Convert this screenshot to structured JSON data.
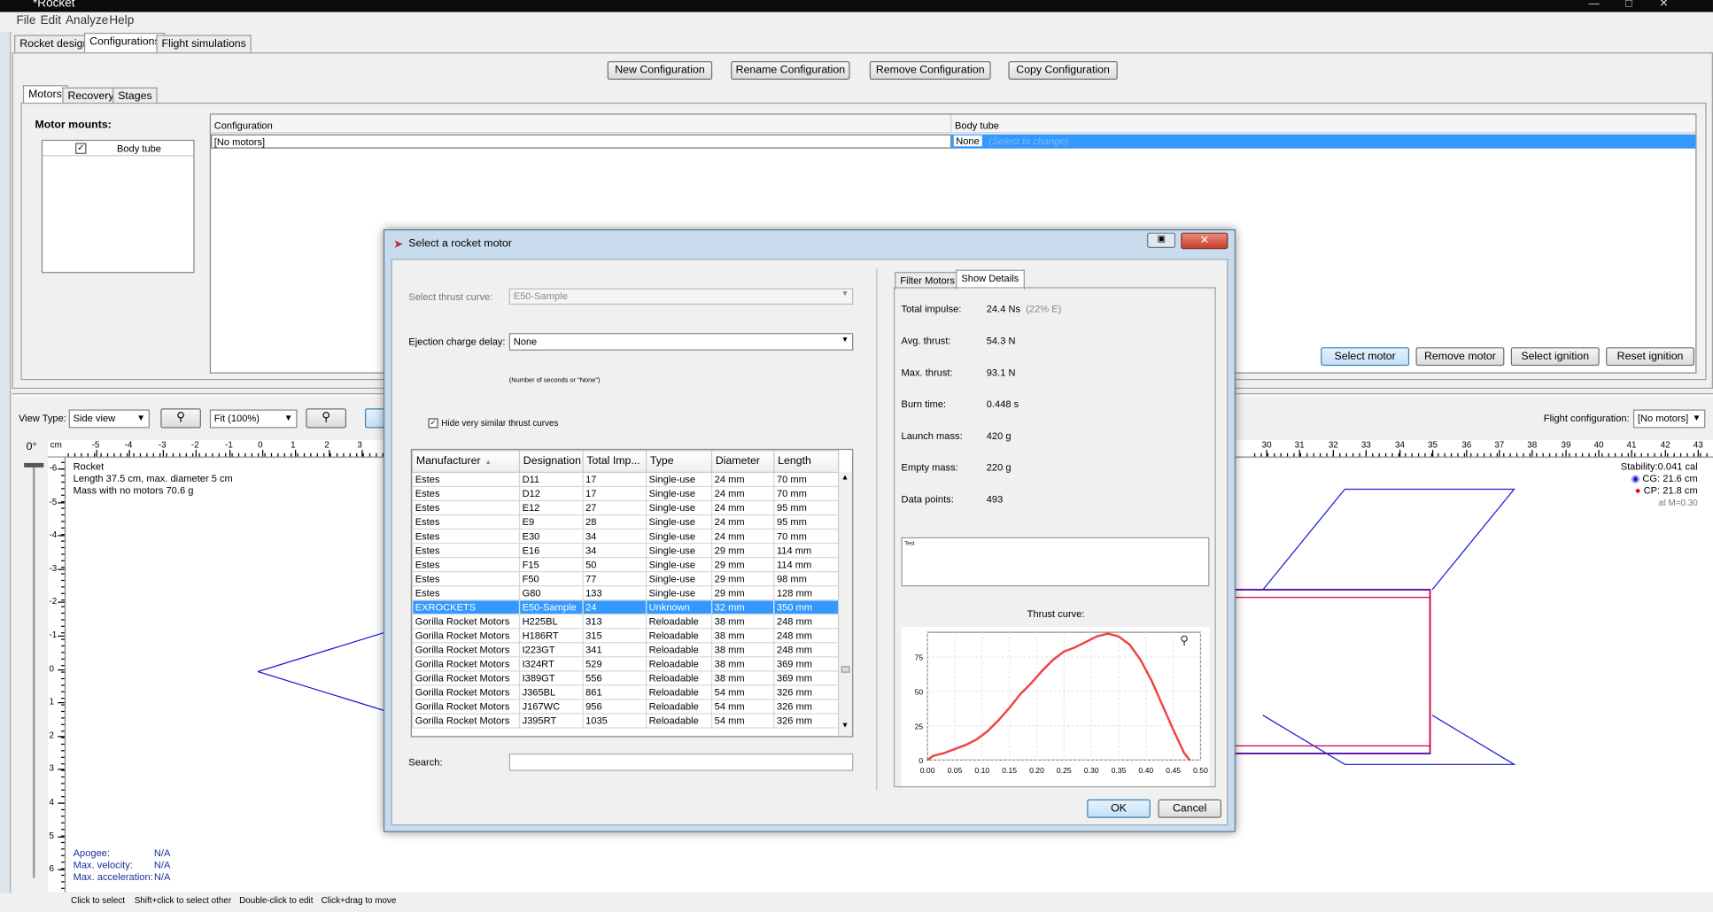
{
  "window": {
    "title": "*Rocket"
  },
  "menu": [
    "File",
    "Edit",
    "Analyze",
    "Help"
  ],
  "main_tabs": [
    "Rocket design",
    "Configurations",
    "Flight simulations"
  ],
  "config_buttons": [
    "New Configuration",
    "Rename Configuration",
    "Remove Configuration",
    "Copy Configuration"
  ],
  "sub_tabs": [
    "Motors",
    "Recovery",
    "Stages"
  ],
  "motor_mounts": {
    "label": "Motor mounts:",
    "item": "Body tube"
  },
  "config_table": {
    "headers": [
      "Configuration",
      "Body tube"
    ],
    "row": [
      "[No motors]",
      "None"
    ],
    "selected_placeholder": "(Select to change)"
  },
  "motor_buttons": [
    "Select motor",
    "Remove motor",
    "Select ignition",
    "Reset ignition"
  ],
  "view": {
    "type_label": "View Type:",
    "type_value": "Side view",
    "zoom": "Fit (100%)",
    "flight_config_label": "Flight configuration:",
    "flight_config_value": "[No motors]",
    "angle": "0°",
    "unit": "cm"
  },
  "rocket_info": {
    "name": "Rocket",
    "length": "Length 37.5 cm, max. diameter 5 cm",
    "mass": "Mass with no motors 70.6 g"
  },
  "stability": {
    "stability": "Stability:",
    "stab_val": "0.041 cal",
    "cg_label": "CG:",
    "cg": "21.6 cm",
    "cp_label": "CP:",
    "cp": "21.8 cm",
    "mach": "at M=0.30"
  },
  "flight_info": {
    "apogee_label": "Apogee:",
    "velocity_label": "Max. velocity:",
    "accel_label": "Max. acceleration:",
    "apogee": "N/A",
    "velocity": "N/A",
    "accel": "N/A"
  },
  "status_bar": [
    "Click to select",
    "Shift+click to select other",
    "Double-click to edit",
    "Click+drag to move"
  ],
  "ruler_h": [
    "-5",
    "-4",
    "-3",
    "-2",
    "-1",
    "0",
    "1",
    "2",
    "3",
    "30",
    "31",
    "32",
    "33",
    "34",
    "35",
    "36",
    "37",
    "38",
    "39",
    "40",
    "41",
    "42",
    "43"
  ],
  "ruler_v": [
    "-6",
    "-5",
    "-4",
    "-3",
    "-2",
    "-1",
    "0",
    "1",
    "2",
    "3",
    "4",
    "5",
    "6"
  ],
  "dialog": {
    "title": "Select a rocket motor",
    "thrust_curve_label": "Select thrust curve:",
    "thrust_curve_value": "E50-Sample",
    "ejection_label": "Ejection charge delay:",
    "ejection_value": "None",
    "ejection_hint": "(Number of seconds or \"None\")",
    "hide_similar": "Hide very similar thrust curves",
    "search_label": "Search:",
    "tabs": [
      "Filter Motors",
      "Show Details"
    ],
    "ok": "OK",
    "cancel": "Cancel",
    "table_headers": [
      "Manufacturer",
      "Designation",
      "Total Imp...",
      "Type",
      "Diameter",
      "Length"
    ],
    "rows": [
      [
        "Estes",
        "D11",
        "17",
        "Single-use",
        "24 mm",
        "70 mm"
      ],
      [
        "Estes",
        "D12",
        "17",
        "Single-use",
        "24 mm",
        "70 mm"
      ],
      [
        "Estes",
        "E12",
        "27",
        "Single-use",
        "24 mm",
        "95 mm"
      ],
      [
        "Estes",
        "E9",
        "28",
        "Single-use",
        "24 mm",
        "95 mm"
      ],
      [
        "Estes",
        "E30",
        "34",
        "Single-use",
        "24 mm",
        "70 mm"
      ],
      [
        "Estes",
        "E16",
        "34",
        "Single-use",
        "29 mm",
        "114 mm"
      ],
      [
        "Estes",
        "F15",
        "50",
        "Single-use",
        "29 mm",
        "114 mm"
      ],
      [
        "Estes",
        "F50",
        "77",
        "Single-use",
        "29 mm",
        "98 mm"
      ],
      [
        "Estes",
        "G80",
        "133",
        "Single-use",
        "29 mm",
        "128 mm"
      ],
      [
        "EXROCKETS",
        "E50-Sample",
        "24",
        "Unknown",
        "32 mm",
        "350 mm"
      ],
      [
        "Gorilla Rocket Motors",
        "H225BL",
        "313",
        "Reloadable",
        "38 mm",
        "248 mm"
      ],
      [
        "Gorilla Rocket Motors",
        "H186RT",
        "315",
        "Reloadable",
        "38 mm",
        "248 mm"
      ],
      [
        "Gorilla Rocket Motors",
        "I223GT",
        "341",
        "Reloadable",
        "38 mm",
        "248 mm"
      ],
      [
        "Gorilla Rocket Motors",
        "I324RT",
        "529",
        "Reloadable",
        "38 mm",
        "369 mm"
      ],
      [
        "Gorilla Rocket Motors",
        "I389GT",
        "556",
        "Reloadable",
        "38 mm",
        "369 mm"
      ],
      [
        "Gorilla Rocket Motors",
        "J365BL",
        "861",
        "Reloadable",
        "54 mm",
        "326 mm"
      ],
      [
        "Gorilla Rocket Motors",
        "J167WC",
        "956",
        "Reloadable",
        "54 mm",
        "326 mm"
      ],
      [
        "Gorilla Rocket Motors",
        "J395RT",
        "1035",
        "Reloadable",
        "54 mm",
        "326 mm"
      ]
    ],
    "selected_row": 9,
    "details": [
      {
        "label": "Total impulse:",
        "value": "24.4 Ns",
        "extra": "(22% E)"
      },
      {
        "label": "Avg. thrust:",
        "value": "54.3 N"
      },
      {
        "label": "Max. thrust:",
        "value": "93.1 N"
      },
      {
        "label": "Burn time:",
        "value": "0.448 s"
      },
      {
        "label": "Launch mass:",
        "value": "420 g"
      },
      {
        "label": "Empty mass:",
        "value": "220 g"
      },
      {
        "label": "Data points:",
        "value": "493"
      }
    ],
    "comment": "Test",
    "thrust_title": "Thrust curve:"
  },
  "chart_data": {
    "type": "line",
    "title": "Thrust curve:",
    "xlabel": "",
    "ylabel": "",
    "xlim": [
      0,
      0.5
    ],
    "ylim": [
      0,
      93
    ],
    "xticks": [
      "0.00",
      "0.05",
      "0.10",
      "0.15",
      "0.20",
      "0.25",
      "0.30",
      "0.35",
      "0.40",
      "0.45",
      "0.50"
    ],
    "yticks": [
      "0",
      "25",
      "50",
      "75"
    ],
    "series": [
      {
        "color": "#ee4444",
        "x": [
          0.0,
          0.01,
          0.03,
          0.05,
          0.07,
          0.09,
          0.11,
          0.13,
          0.15,
          0.17,
          0.19,
          0.21,
          0.23,
          0.25,
          0.27,
          0.29,
          0.31,
          0.33,
          0.35,
          0.37,
          0.39,
          0.41,
          0.43,
          0.45,
          0.47,
          0.48
        ],
        "y": [
          0,
          3,
          5,
          8,
          11,
          15,
          21,
          29,
          38,
          48,
          56,
          65,
          73,
          79,
          82,
          86,
          90,
          92,
          90,
          84,
          73,
          58,
          40,
          22,
          5,
          0
        ]
      }
    ]
  },
  "colors": {
    "selection": "#3399ff",
    "cp": "#ff0000",
    "cg": "#0000cc",
    "rocket": "#1a1ad6",
    "motor": "#cc0044"
  }
}
